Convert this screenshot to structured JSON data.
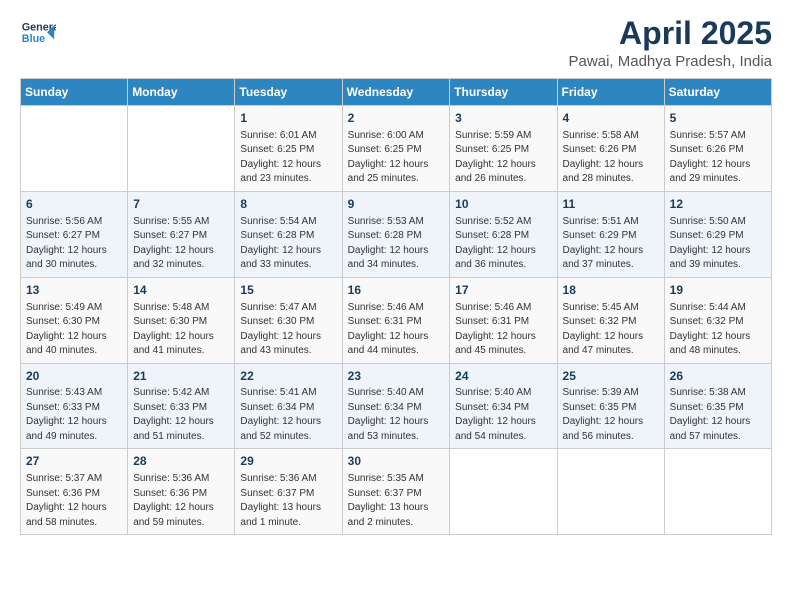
{
  "header": {
    "logo_line1": "General",
    "logo_line2": "Blue",
    "title": "April 2025",
    "subtitle": "Pawai, Madhya Pradesh, India"
  },
  "calendar": {
    "days_of_week": [
      "Sunday",
      "Monday",
      "Tuesday",
      "Wednesday",
      "Thursday",
      "Friday",
      "Saturday"
    ],
    "weeks": [
      [
        {
          "day": "",
          "content": ""
        },
        {
          "day": "",
          "content": ""
        },
        {
          "day": "1",
          "content": "Sunrise: 6:01 AM\nSunset: 6:25 PM\nDaylight: 12 hours and 23 minutes."
        },
        {
          "day": "2",
          "content": "Sunrise: 6:00 AM\nSunset: 6:25 PM\nDaylight: 12 hours and 25 minutes."
        },
        {
          "day": "3",
          "content": "Sunrise: 5:59 AM\nSunset: 6:25 PM\nDaylight: 12 hours and 26 minutes."
        },
        {
          "day": "4",
          "content": "Sunrise: 5:58 AM\nSunset: 6:26 PM\nDaylight: 12 hours and 28 minutes."
        },
        {
          "day": "5",
          "content": "Sunrise: 5:57 AM\nSunset: 6:26 PM\nDaylight: 12 hours and 29 minutes."
        }
      ],
      [
        {
          "day": "6",
          "content": "Sunrise: 5:56 AM\nSunset: 6:27 PM\nDaylight: 12 hours and 30 minutes."
        },
        {
          "day": "7",
          "content": "Sunrise: 5:55 AM\nSunset: 6:27 PM\nDaylight: 12 hours and 32 minutes."
        },
        {
          "day": "8",
          "content": "Sunrise: 5:54 AM\nSunset: 6:28 PM\nDaylight: 12 hours and 33 minutes."
        },
        {
          "day": "9",
          "content": "Sunrise: 5:53 AM\nSunset: 6:28 PM\nDaylight: 12 hours and 34 minutes."
        },
        {
          "day": "10",
          "content": "Sunrise: 5:52 AM\nSunset: 6:28 PM\nDaylight: 12 hours and 36 minutes."
        },
        {
          "day": "11",
          "content": "Sunrise: 5:51 AM\nSunset: 6:29 PM\nDaylight: 12 hours and 37 minutes."
        },
        {
          "day": "12",
          "content": "Sunrise: 5:50 AM\nSunset: 6:29 PM\nDaylight: 12 hours and 39 minutes."
        }
      ],
      [
        {
          "day": "13",
          "content": "Sunrise: 5:49 AM\nSunset: 6:30 PM\nDaylight: 12 hours and 40 minutes."
        },
        {
          "day": "14",
          "content": "Sunrise: 5:48 AM\nSunset: 6:30 PM\nDaylight: 12 hours and 41 minutes."
        },
        {
          "day": "15",
          "content": "Sunrise: 5:47 AM\nSunset: 6:30 PM\nDaylight: 12 hours and 43 minutes."
        },
        {
          "day": "16",
          "content": "Sunrise: 5:46 AM\nSunset: 6:31 PM\nDaylight: 12 hours and 44 minutes."
        },
        {
          "day": "17",
          "content": "Sunrise: 5:46 AM\nSunset: 6:31 PM\nDaylight: 12 hours and 45 minutes."
        },
        {
          "day": "18",
          "content": "Sunrise: 5:45 AM\nSunset: 6:32 PM\nDaylight: 12 hours and 47 minutes."
        },
        {
          "day": "19",
          "content": "Sunrise: 5:44 AM\nSunset: 6:32 PM\nDaylight: 12 hours and 48 minutes."
        }
      ],
      [
        {
          "day": "20",
          "content": "Sunrise: 5:43 AM\nSunset: 6:33 PM\nDaylight: 12 hours and 49 minutes."
        },
        {
          "day": "21",
          "content": "Sunrise: 5:42 AM\nSunset: 6:33 PM\nDaylight: 12 hours and 51 minutes."
        },
        {
          "day": "22",
          "content": "Sunrise: 5:41 AM\nSunset: 6:34 PM\nDaylight: 12 hours and 52 minutes."
        },
        {
          "day": "23",
          "content": "Sunrise: 5:40 AM\nSunset: 6:34 PM\nDaylight: 12 hours and 53 minutes."
        },
        {
          "day": "24",
          "content": "Sunrise: 5:40 AM\nSunset: 6:34 PM\nDaylight: 12 hours and 54 minutes."
        },
        {
          "day": "25",
          "content": "Sunrise: 5:39 AM\nSunset: 6:35 PM\nDaylight: 12 hours and 56 minutes."
        },
        {
          "day": "26",
          "content": "Sunrise: 5:38 AM\nSunset: 6:35 PM\nDaylight: 12 hours and 57 minutes."
        }
      ],
      [
        {
          "day": "27",
          "content": "Sunrise: 5:37 AM\nSunset: 6:36 PM\nDaylight: 12 hours and 58 minutes."
        },
        {
          "day": "28",
          "content": "Sunrise: 5:36 AM\nSunset: 6:36 PM\nDaylight: 12 hours and 59 minutes."
        },
        {
          "day": "29",
          "content": "Sunrise: 5:36 AM\nSunset: 6:37 PM\nDaylight: 13 hours and 1 minute."
        },
        {
          "day": "30",
          "content": "Sunrise: 5:35 AM\nSunset: 6:37 PM\nDaylight: 13 hours and 2 minutes."
        },
        {
          "day": "",
          "content": ""
        },
        {
          "day": "",
          "content": ""
        },
        {
          "day": "",
          "content": ""
        }
      ]
    ]
  }
}
